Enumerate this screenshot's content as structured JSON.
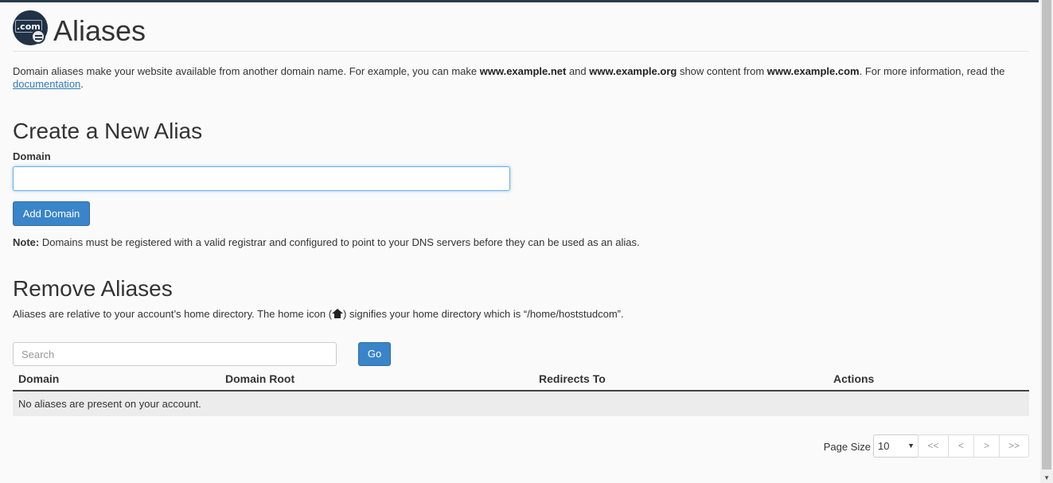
{
  "header": {
    "title": "Aliases",
    "logo_text": ".com"
  },
  "intro": {
    "part1": "Domain aliases make your website available from another domain name. For example, you can make ",
    "ex1": "www.example.net",
    "part2": " and ",
    "ex2": "www.example.org",
    "part3": " show content from ",
    "ex3": "www.example.com",
    "part4": ". For more information, read the ",
    "link": "documentation",
    "part5": "."
  },
  "create": {
    "heading": "Create a New Alias",
    "domain_label": "Domain",
    "domain_value": "",
    "add_button": "Add Domain",
    "note_label": "Note:",
    "note_text": " Domains must be registered with a valid registrar and configured to point to your DNS servers before they can be used as an alias."
  },
  "remove": {
    "heading": "Remove Aliases",
    "desc_part1": "Aliases are relative to your account’s home directory. The home icon (",
    "desc_part2": ") signifies your home directory which is “/home/hoststudcom”.",
    "search_placeholder": "Search",
    "go_button": "Go",
    "columns": [
      "Domain",
      "Domain Root",
      "Redirects To",
      "Actions"
    ],
    "empty_message": "No aliases are present on your account."
  },
  "pagination": {
    "page_size_label": "Page Size",
    "page_size_value": "10",
    "buttons": [
      "<<",
      "<",
      ">",
      ">>"
    ]
  },
  "icons": {
    "home": "home-icon",
    "logo": "domain-alias-icon",
    "dropdown": "chevron-down-icon"
  },
  "colors": {
    "primary": "#3a85c9",
    "topbar": "#293a4a",
    "brand_orange": "#ff6c2c"
  }
}
